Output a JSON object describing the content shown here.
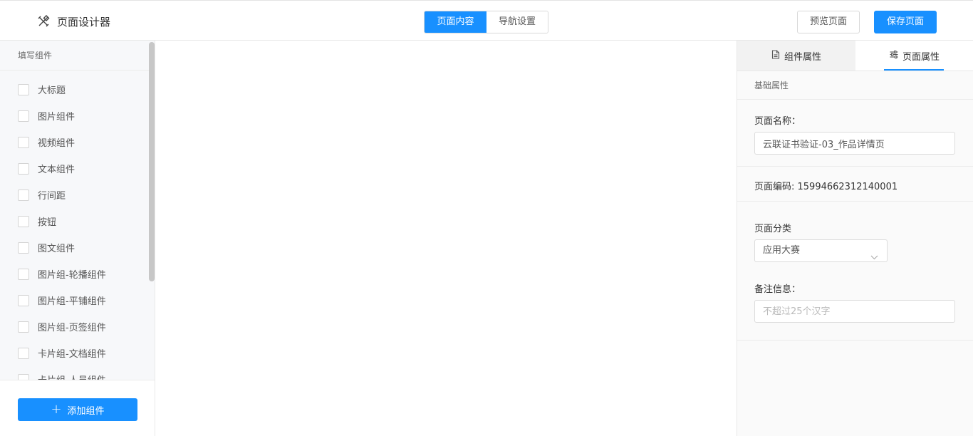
{
  "header": {
    "title": "页面设计器",
    "tabs": [
      {
        "label": "页面内容",
        "active": true
      },
      {
        "label": "导航设置",
        "active": false
      }
    ],
    "preview_label": "预览页面",
    "save_label": "保存页面"
  },
  "left_panel": {
    "heading": "填写组件",
    "items": [
      "大标题",
      "图片组件",
      "视频组件",
      "文本组件",
      "行间距",
      "按钮",
      "图文组件",
      "图片组-轮播组件",
      "图片组-平铺组件",
      "图片组-页签组件",
      "卡片组-文档组件",
      "卡片组-人员组件"
    ],
    "add_label": "添加组件"
  },
  "right_panel": {
    "tabs": [
      {
        "label": "组件属性",
        "icon": "document-icon"
      },
      {
        "label": "页面属性",
        "icon": "sliders-icon"
      }
    ],
    "section_title": "基础属性",
    "page_name_label": "页面名称：",
    "page_name_value": "云联证书验证-03_作品详情页",
    "page_code_text": "页面编码: 15994662312140001",
    "page_category_label": "页面分类",
    "page_category_value": "应用大赛",
    "remarks_label": "备注信息：",
    "remarks_placeholder": "不超过25个汉字"
  },
  "colors": {
    "primary": "#1890ff",
    "panel_bg": "#f7f8fa",
    "border": "#e8e8e8"
  }
}
